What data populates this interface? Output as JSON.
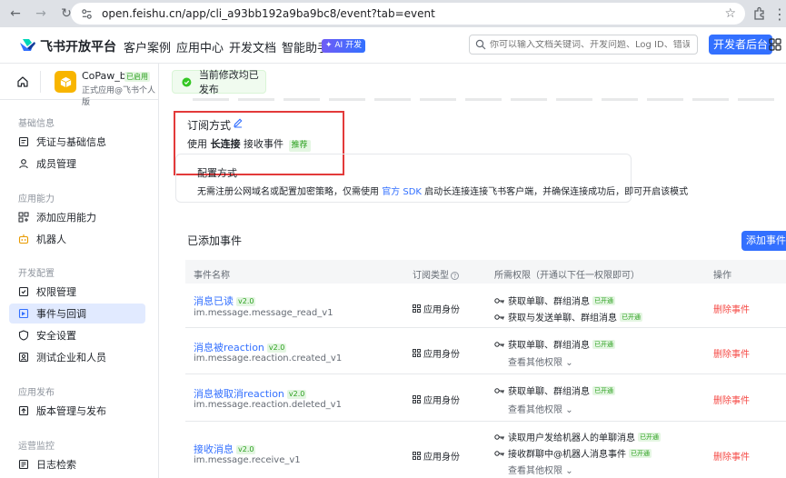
{
  "browser": {
    "url": "open.feishu.cn/app/cli_a93bb192a9ba9bc8/event?tab=event"
  },
  "header": {
    "brand": "飞书开放平台",
    "nav": [
      "客户案例",
      "应用中心",
      "开发文档",
      "智能助手"
    ],
    "ai_badge": "✦ AI 开发",
    "search_placeholder": "你可以输入文档关键词、开发问题、Log ID、错误码",
    "dev_console": "开发者后台"
  },
  "app": {
    "name": "CoPaw_bot",
    "status": "已启用",
    "subtitle": "正式应用@飞书个人版"
  },
  "toast": "当前修改均已发布",
  "sidebar": {
    "sections": [
      {
        "title": "基础信息",
        "items": [
          "凭证与基础信息",
          "成员管理"
        ]
      },
      {
        "title": "应用能力",
        "items": [
          "添加应用能力",
          "机器人"
        ]
      },
      {
        "title": "开发配置",
        "items": [
          "权限管理",
          "事件与回调",
          "安全设置",
          "测试企业和人员"
        ]
      },
      {
        "title": "应用发布",
        "items": [
          "版本管理与发布"
        ]
      },
      {
        "title": "运营监控",
        "items": [
          "日志检索"
        ]
      }
    ]
  },
  "subscription": {
    "title": "订阅方式",
    "prefix": "使用",
    "mode": "长连接",
    "suffix": "接收事件",
    "recommend": "推荐",
    "config_title": "配置方式",
    "config_desc_1": "无需注册公网域名或配置加密策略，仅需使用",
    "config_link": "官方 SDK",
    "config_desc_2": "启动长连接连接飞书客户端，并确保连接成功后，即可开启该模式"
  },
  "events": {
    "title": "已添加事件",
    "add_button": "添加事件",
    "columns": [
      "事件名称",
      "订阅类型",
      "所需权限（开通以下任一权限即可）",
      "操作"
    ],
    "more_perms": "查看其他权限",
    "open_label": "已开通",
    "delete_label": "删除事件",
    "rows": [
      {
        "name": "消息已读",
        "version": "v2.0",
        "id": "im.message.message_read_v1",
        "type": "应用身份",
        "perms": [
          "获取单聊、群组消息",
          "获取与发送单聊、群组消息"
        ],
        "more": false
      },
      {
        "name": "消息被reaction",
        "version": "v2.0",
        "id": "im.message.reaction.created_v1",
        "type": "应用身份",
        "perms": [
          "获取单聊、群组消息"
        ],
        "more": true
      },
      {
        "name": "消息被取消reaction",
        "version": "v2.0",
        "id": "im.message.reaction.deleted_v1",
        "type": "应用身份",
        "perms": [
          "获取单聊、群组消息"
        ],
        "more": true
      },
      {
        "name": "接收消息",
        "version": "v2.0",
        "id": "im.message.receive_v1",
        "type": "应用身份",
        "perms": [
          "读取用户发给机器人的单聊消息",
          "接收群聊中@机器人消息事件"
        ],
        "more": true
      }
    ]
  }
}
